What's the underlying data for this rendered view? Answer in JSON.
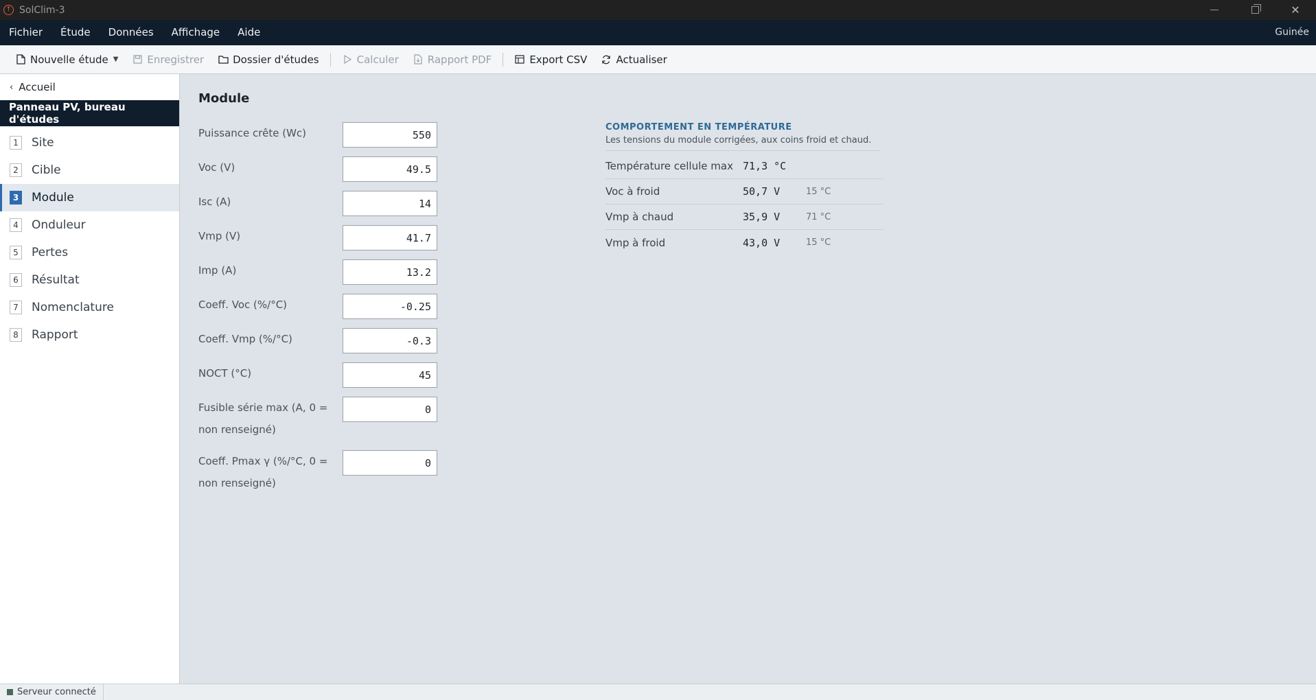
{
  "window": {
    "title": "SolClim-3"
  },
  "menu": {
    "items": [
      "Fichier",
      "Étude",
      "Données",
      "Affichage",
      "Aide"
    ],
    "region": "Guinée"
  },
  "toolbar": {
    "new_study": "Nouvelle étude",
    "save": "Enregistrer",
    "folder": "Dossier d'études",
    "compute": "Calculer",
    "pdf": "Rapport PDF",
    "csv": "Export CSV",
    "refresh": "Actualiser"
  },
  "sidebar": {
    "back": "Accueil",
    "study_title": "Panneau PV, bureau d'études",
    "steps": [
      {
        "num": "1",
        "label": "Site"
      },
      {
        "num": "2",
        "label": "Cible"
      },
      {
        "num": "3",
        "label": "Module"
      },
      {
        "num": "4",
        "label": "Onduleur"
      },
      {
        "num": "5",
        "label": "Pertes"
      },
      {
        "num": "6",
        "label": "Résultat"
      },
      {
        "num": "7",
        "label": "Nomenclature"
      },
      {
        "num": "8",
        "label": "Rapport"
      }
    ],
    "active_step": "3"
  },
  "main": {
    "title": "Module",
    "fields": [
      {
        "label": "Puissance crête (Wc)",
        "value": "550"
      },
      {
        "label": "Voc (V)",
        "value": "49.5"
      },
      {
        "label": "Isc (A)",
        "value": "14"
      },
      {
        "label": "Vmp (V)",
        "value": "41.7"
      },
      {
        "label": "Imp (A)",
        "value": "13.2"
      },
      {
        "label": "Coeff. Voc (%/°C)",
        "value": "-0.25"
      },
      {
        "label": "Coeff. Vmp (%/°C)",
        "value": "-0.3"
      },
      {
        "label": "NOCT (°C)",
        "value": "45"
      },
      {
        "label": "Fusible série max (A, 0 = non renseigné)",
        "value": "0"
      },
      {
        "label": "Coeff. Pmax γ (%/°C, 0 = non renseigné)",
        "value": "0"
      }
    ]
  },
  "temperature": {
    "heading": "COMPORTEMENT EN TEMPÉRATURE",
    "subtitle": "Les tensions du module corrigées, aux coins froid et chaud.",
    "rows": [
      {
        "label": "Température cellule max",
        "value": "71,3 °C",
        "note": ""
      },
      {
        "label": "Voc à froid",
        "value": "50,7 V",
        "note": "15 °C"
      },
      {
        "label": "Vmp à chaud",
        "value": "35,9 V",
        "note": "71 °C"
      },
      {
        "label": "Vmp à froid",
        "value": "43,0 V",
        "note": "15 °C"
      }
    ]
  },
  "status": {
    "server": "Serveur connecté"
  }
}
